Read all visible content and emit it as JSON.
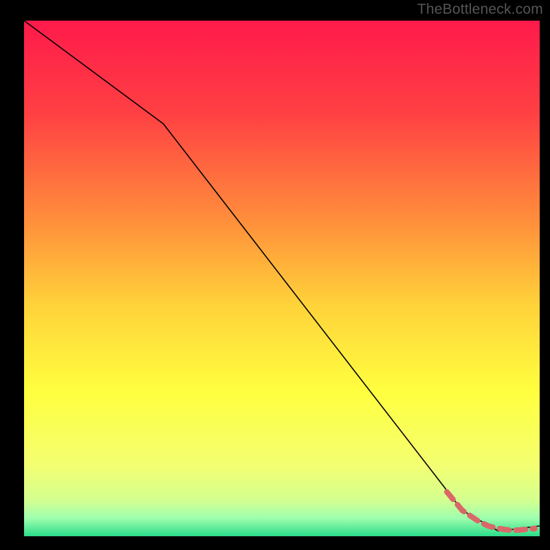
{
  "attribution": "TheBottleneck.com",
  "chart_data": {
    "type": "line",
    "title": "",
    "xlabel": "",
    "ylabel": "",
    "xlim": [
      0,
      100
    ],
    "ylim": [
      0,
      100
    ],
    "series": [
      {
        "name": "main-curve",
        "x": [
          0,
          27,
          85,
          92,
          100
        ],
        "y": [
          100,
          80,
          5,
          1,
          2
        ],
        "stroke": "#000000",
        "stroke_width": 1.6
      },
      {
        "name": "highlight-segment",
        "x": [
          82,
          85,
          88,
          90,
          92,
          94,
          96,
          99
        ],
        "y": [
          8.6,
          5,
          3,
          2,
          1.5,
          1.2,
          1.2,
          1.5
        ],
        "stroke": "#d96868",
        "stroke_width": 8,
        "dash": true,
        "end_marker": true
      }
    ],
    "background_gradient": {
      "stops": [
        {
          "offset": 0.0,
          "color": "#ff1a4b"
        },
        {
          "offset": 0.18,
          "color": "#ff4043"
        },
        {
          "offset": 0.4,
          "color": "#ff933b"
        },
        {
          "offset": 0.55,
          "color": "#ffd23a"
        },
        {
          "offset": 0.72,
          "color": "#ffff3f"
        },
        {
          "offset": 0.86,
          "color": "#f4ff70"
        },
        {
          "offset": 0.93,
          "color": "#d4ff90"
        },
        {
          "offset": 0.965,
          "color": "#9effae"
        },
        {
          "offset": 1.0,
          "color": "#2cdc8a"
        }
      ]
    }
  }
}
